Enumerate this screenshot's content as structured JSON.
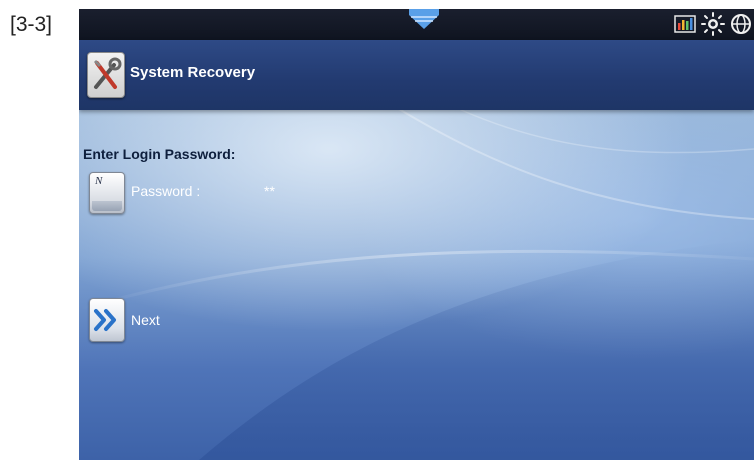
{
  "figure_label": "[3-3]",
  "status_bar": {
    "icons": [
      "signal-bars-icon",
      "brightness-icon",
      "globe-icon"
    ]
  },
  "title_bar": {
    "title": "System Recovery",
    "icon": "tools-icon"
  },
  "login": {
    "heading": "Enter Login Password:",
    "password_key_letter": "N",
    "password_label": "Password :",
    "password_value": "**"
  },
  "navigation": {
    "next_label": "Next",
    "next_icon": "double-chevron-right-icon"
  },
  "colors": {
    "status_bar": "#1a1f2e",
    "title_bar": "#2e4a86",
    "next_arrow": "#2a73c9"
  }
}
